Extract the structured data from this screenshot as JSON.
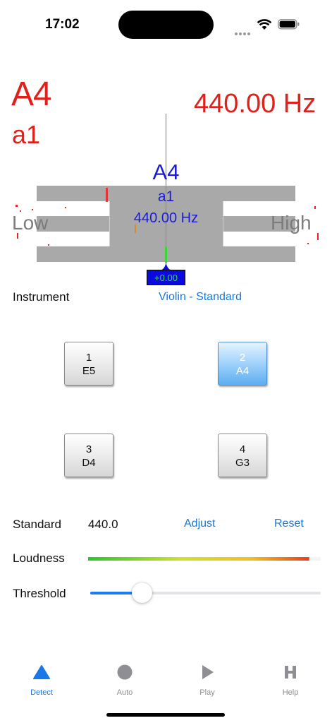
{
  "status_bar": {
    "time": "17:02"
  },
  "readout": {
    "note": "A4",
    "octave_name": "a1",
    "frequency": "440.00 Hz"
  },
  "meter": {
    "note": "A4",
    "octave_name": "a1",
    "frequency": "440.00 Hz",
    "low_label": "Low",
    "high_label": "High",
    "cents": "+0.00"
  },
  "instrument": {
    "label": "Instrument",
    "value": "Violin - Standard"
  },
  "strings": [
    {
      "number": "1",
      "note": "E5",
      "selected": false
    },
    {
      "number": "2",
      "note": "A4",
      "selected": true
    },
    {
      "number": "3",
      "note": "D4",
      "selected": false
    },
    {
      "number": "4",
      "note": "G3",
      "selected": false
    }
  ],
  "standard": {
    "label": "Standard",
    "value": "440.0",
    "adjust": "Adjust",
    "reset": "Reset"
  },
  "loudness": {
    "label": "Loudness",
    "level": 0.85
  },
  "threshold": {
    "label": "Threshold",
    "value": 0.22
  },
  "tabs": [
    {
      "label": "Detect",
      "icon": "triangle-icon",
      "active": true
    },
    {
      "label": "Auto",
      "icon": "circle-icon",
      "active": false
    },
    {
      "label": "Play",
      "icon": "play-icon",
      "active": false
    },
    {
      "label": "Help",
      "icon": "help-h-icon",
      "active": false
    }
  ],
  "colors": {
    "accent": "#1a78e6",
    "readout": "#e0211b",
    "meter_text": "#1a1ad8",
    "selected_button": "#5daef0"
  }
}
